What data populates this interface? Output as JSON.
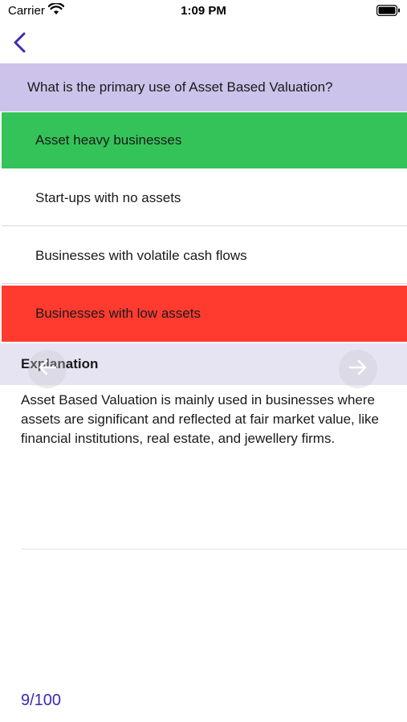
{
  "status_bar": {
    "carrier": "Carrier",
    "time": "1:09 PM",
    "icons": [
      "wifi-icon",
      "battery-icon"
    ]
  },
  "nav": {
    "back_icon": "chevron-left-icon",
    "accent_color": "#3b2bb0"
  },
  "question": {
    "text": "What is the primary use of Asset Based Valuation?",
    "background": "#ccc3ea"
  },
  "options": [
    {
      "label": "Asset heavy businesses",
      "state": "correct",
      "color": "#34c359"
    },
    {
      "label": "Start-ups with no assets",
      "state": "neutral",
      "color": "#ffffff"
    },
    {
      "label": "Businesses with volatile cash flows",
      "state": "neutral",
      "color": "#ffffff"
    },
    {
      "label": "Businesses with low assets",
      "state": "incorrect",
      "color": "#ff3b30"
    }
  ],
  "explanation": {
    "heading": "Explanation",
    "body": "Asset Based Valuation is mainly used in businesses where assets are significant and reflected at fair market value, like financial institutions, real estate, and jewellery firms."
  },
  "navigation": {
    "prev_icon": "arrow-left-icon",
    "next_icon": "arrow-right-icon"
  },
  "progress": {
    "text": "9/100"
  }
}
